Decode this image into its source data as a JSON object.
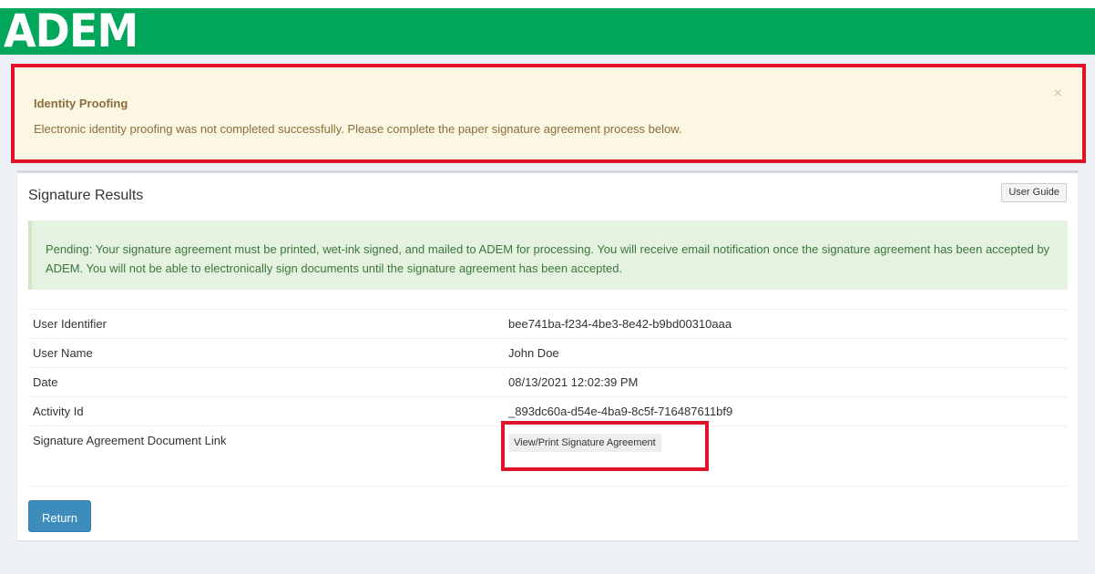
{
  "header": {
    "logo_text": "ADEM"
  },
  "callout": {
    "title": "Identity Proofing",
    "message": "Electronic identity proofing was not completed successfully. Please complete the paper signature agreement process below.",
    "close_glyph": "×"
  },
  "box": {
    "title": "Signature Results",
    "user_guide_label": "User Guide",
    "alert_text": "Pending: Your signature agreement must be printed, wet-ink signed, and mailed to ADEM for processing. You will receive email notification once the signature agreement has been accepted by ADEM. You will not be able to electronically sign documents until the signature agreement has been accepted."
  },
  "details": {
    "rows": [
      {
        "label": "User Identifier",
        "value": "bee741ba-f234-4be3-8e42-b9bd00310aaa"
      },
      {
        "label": "User Name",
        "value": "John Doe"
      },
      {
        "label": "Date",
        "value": "08/13/2021 12:02:39 PM"
      },
      {
        "label": "Activity Id",
        "value": "_893dc60a-d54e-4ba9-8c5f-716487611bf9"
      }
    ],
    "doc_link_label": "Signature Agreement Document Link",
    "doc_link_button": "View/Print Signature Agreement"
  },
  "footer": {
    "return_label": "Return"
  },
  "colors": {
    "header_green": "#00a65a",
    "callout_bg": "#fcf7e3",
    "callout_text": "#8a6d3b",
    "highlight_red": "#e0132b",
    "alert_bg": "#e4f2df",
    "alert_text": "#3c763d",
    "primary_button": "#3c8dbc"
  }
}
